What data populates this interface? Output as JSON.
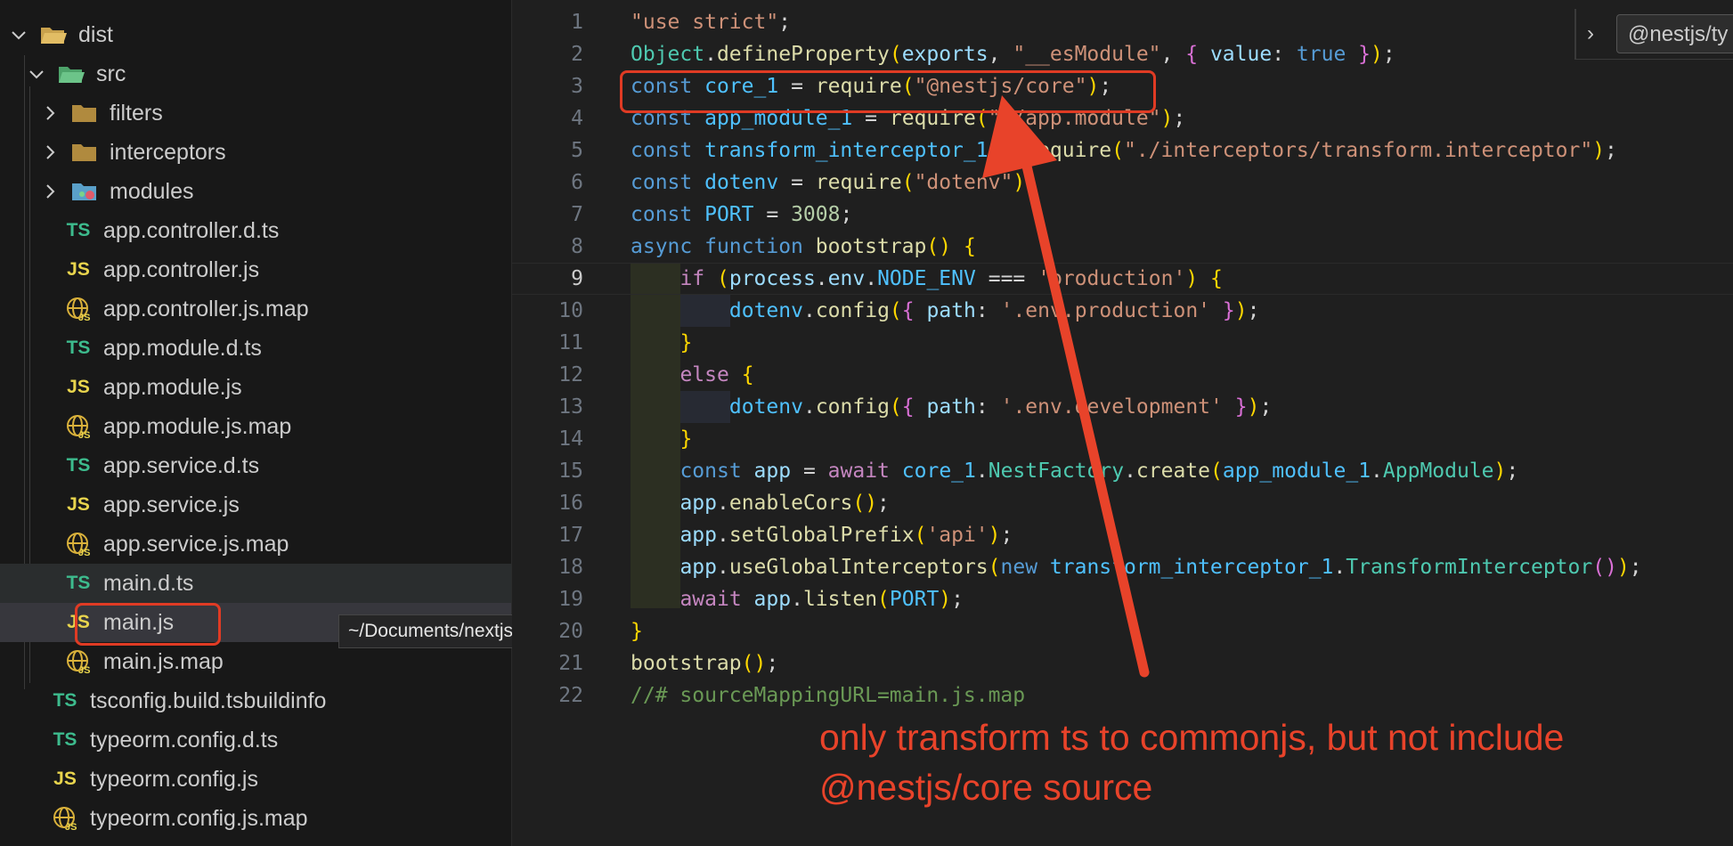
{
  "sidebar": {
    "items": [
      {
        "label": "dist",
        "type": "folder-open",
        "icon": "dist-folder-icon"
      },
      {
        "label": "src",
        "type": "folder-open",
        "icon": "src-folder-icon"
      },
      {
        "label": "filters",
        "type": "folder",
        "icon": "folder-icon"
      },
      {
        "label": "interceptors",
        "type": "folder",
        "icon": "folder-icon"
      },
      {
        "label": "modules",
        "type": "folder",
        "icon": "modules-folder-icon"
      },
      {
        "label": "app.controller.d.ts",
        "type": "ts",
        "badge": "TS"
      },
      {
        "label": "app.controller.js",
        "type": "js",
        "badge": "JS"
      },
      {
        "label": "app.controller.js.map",
        "type": "map",
        "icon": "map-file-icon"
      },
      {
        "label": "app.module.d.ts",
        "type": "ts",
        "badge": "TS"
      },
      {
        "label": "app.module.js",
        "type": "js",
        "badge": "JS"
      },
      {
        "label": "app.module.js.map",
        "type": "map",
        "icon": "map-file-icon"
      },
      {
        "label": "app.service.d.ts",
        "type": "ts",
        "badge": "TS"
      },
      {
        "label": "app.service.js",
        "type": "js",
        "badge": "JS"
      },
      {
        "label": "app.service.js.map",
        "type": "map",
        "icon": "map-file-icon"
      },
      {
        "label": "main.d.ts",
        "type": "ts",
        "badge": "TS",
        "state": "hovered"
      },
      {
        "label": "main.js",
        "type": "js",
        "badge": "JS",
        "state": "selected"
      },
      {
        "label": "main.js.map",
        "type": "map",
        "icon": "map-file-icon"
      },
      {
        "label": "tsconfig.build.tsbuildinfo",
        "type": "ts",
        "badge": "TS"
      },
      {
        "label": "typeorm.config.d.ts",
        "type": "ts",
        "badge": "TS"
      },
      {
        "label": "typeorm.config.js",
        "type": "js",
        "badge": "JS"
      },
      {
        "label": "typeorm.config.js.map",
        "type": "map",
        "icon": "map-file-icon"
      }
    ],
    "tooltip": "~/Documents/nextjs/blog-server/dist/src/main.d.ts"
  },
  "editor": {
    "active_line": 9,
    "line_numbers": [
      "1",
      "2",
      "3",
      "4",
      "5",
      "6",
      "7",
      "8",
      "9",
      "10",
      "11",
      "12",
      "13",
      "14",
      "15",
      "16",
      "17",
      "18",
      "19",
      "20",
      "21",
      "22"
    ],
    "lines": [
      "\"use strict\";",
      "Object.defineProperty(exports, \"__esModule\", { value: true });",
      "const core_1 = require(\"@nestjs/core\");",
      "const app_module_1 = require(\"./app.module\");",
      "const transform_interceptor_1 = require(\"./interceptors/transform.interceptor\");",
      "const dotenv = require(\"dotenv\");",
      "const PORT = 3008;",
      "async function bootstrap() {",
      "    if (process.env.NODE_ENV === 'production') {",
      "        dotenv.config({ path: '.env.production' });",
      "    }",
      "    else {",
      "        dotenv.config({ path: '.env.development' });",
      "    }",
      "    const app = await core_1.NestFactory.create(app_module_1.AppModule);",
      "    app.enableCors();",
      "    app.setGlobalPrefix('api');",
      "    app.useGlobalInterceptors(new transform_interceptor_1.TransformInterceptor());",
      "    await app.listen(PORT);",
      "}",
      "bootstrap();",
      "//# sourceMappingURL=main.js.map"
    ],
    "breadcrumb_input": "@nestjs/ty"
  },
  "annotation": {
    "line1": "only transform ts to commonjs, but not include",
    "line2": "@nestjs/core source",
    "color": "#e8432a"
  },
  "colors": {
    "sidebar_bg": "#181818",
    "editor_bg": "#1f1f1f",
    "highlight_red": "#e03b24",
    "ts_badge": "#3dbb8d",
    "js_badge": "#e8d44d"
  }
}
